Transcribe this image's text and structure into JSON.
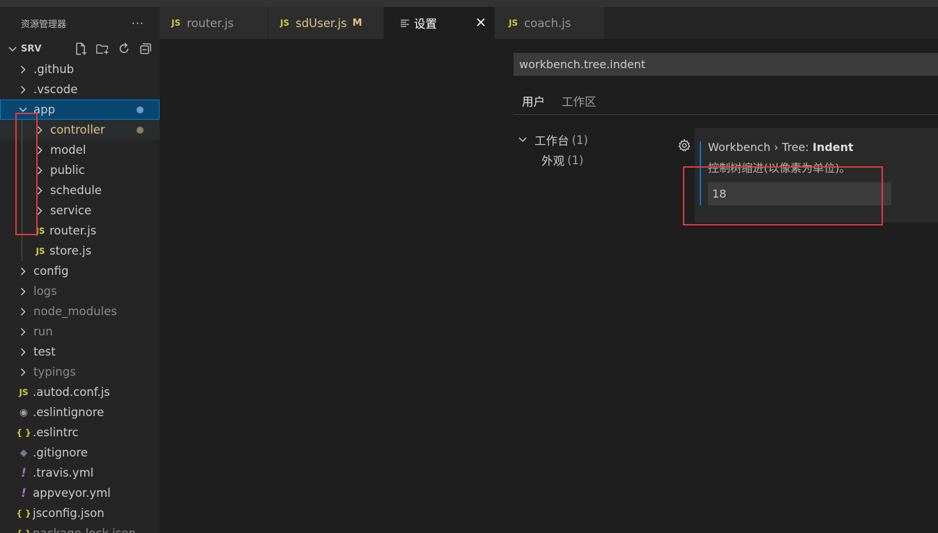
{
  "sidebar": {
    "title": "资源管理器",
    "more": "···",
    "section_title": "SRV",
    "tree": [
      {
        "label": ".github",
        "type": "folder",
        "depth": 0,
        "state": "collapsed"
      },
      {
        "label": ".vscode",
        "type": "folder",
        "depth": 0,
        "state": "collapsed"
      },
      {
        "label": "app",
        "type": "folder",
        "depth": 0,
        "state": "expanded",
        "selected": true,
        "dot": "#6b9bcf"
      },
      {
        "label": "controller",
        "type": "folder",
        "depth": 1,
        "state": "collapsed",
        "modified": true,
        "dot": "#8d7e5c"
      },
      {
        "label": "model",
        "type": "folder",
        "depth": 1,
        "state": "collapsed"
      },
      {
        "label": "public",
        "type": "folder",
        "depth": 1,
        "state": "collapsed"
      },
      {
        "label": "schedule",
        "type": "folder",
        "depth": 1,
        "state": "collapsed"
      },
      {
        "label": "service",
        "type": "folder",
        "depth": 1,
        "state": "collapsed"
      },
      {
        "label": "router.js",
        "type": "file",
        "depth": 1,
        "icon": "js"
      },
      {
        "label": "store.js",
        "type": "file",
        "depth": 1,
        "icon": "js"
      },
      {
        "label": "config",
        "type": "folder",
        "depth": 0,
        "state": "collapsed"
      },
      {
        "label": "logs",
        "type": "folder",
        "depth": 0,
        "state": "collapsed",
        "dim": true
      },
      {
        "label": "node_modules",
        "type": "folder",
        "depth": 0,
        "state": "collapsed",
        "dim": true
      },
      {
        "label": "run",
        "type": "folder",
        "depth": 0,
        "state": "collapsed",
        "dim": true
      },
      {
        "label": "test",
        "type": "folder",
        "depth": 0,
        "state": "collapsed"
      },
      {
        "label": "typings",
        "type": "folder",
        "depth": 0,
        "state": "collapsed",
        "dim": true
      },
      {
        "label": ".autod.conf.js",
        "type": "file",
        "depth": 0,
        "icon": "js"
      },
      {
        "label": ".eslintignore",
        "type": "file",
        "depth": 0,
        "icon": "eslint"
      },
      {
        "label": ".eslintrc",
        "type": "file",
        "depth": 0,
        "icon": "json"
      },
      {
        "label": ".gitignore",
        "type": "file",
        "depth": 0,
        "icon": "git"
      },
      {
        "label": ".travis.yml",
        "type": "file",
        "depth": 0,
        "icon": "yml"
      },
      {
        "label": "appveyor.yml",
        "type": "file",
        "depth": 0,
        "icon": "yml"
      },
      {
        "label": "jsconfig.json",
        "type": "file",
        "depth": 0,
        "icon": "json"
      },
      {
        "label": "package-lock.json",
        "type": "file",
        "depth": 0,
        "icon": "json",
        "dim": true
      }
    ]
  },
  "icons": {
    "js": "JS",
    "json": "{ }",
    "yml": "!",
    "eslint": "◉",
    "git": "◆"
  },
  "tabs": [
    {
      "label": "router.js",
      "icon": "JS",
      "active": false
    },
    {
      "label": "sdUser.js",
      "icon": "JS",
      "active": false,
      "badge": "M"
    },
    {
      "label": "设置",
      "icon": "settings-list",
      "active": true
    },
    {
      "label": "coach.js",
      "icon": "JS",
      "active": false
    }
  ],
  "settings": {
    "search_value": "workbench.tree.indent",
    "scope_tabs": [
      "用户",
      "工作区"
    ],
    "toc": [
      {
        "label": "工作台",
        "count": "(1)"
      },
      {
        "label": "外观",
        "count": "(1)"
      }
    ],
    "item": {
      "category": "Workbench › Tree: ",
      "name": "Indent",
      "description": "控制树缩进(以像素为单位)。",
      "value": "18"
    }
  },
  "colors": {
    "accent": "#007acc",
    "selection": "#094771",
    "highlight_box": "#e5393a",
    "js_icon": "#cbcb41",
    "yml_icon": "#a074c4",
    "json_icon": "#cbcb41",
    "modified": "#e2c08d"
  }
}
